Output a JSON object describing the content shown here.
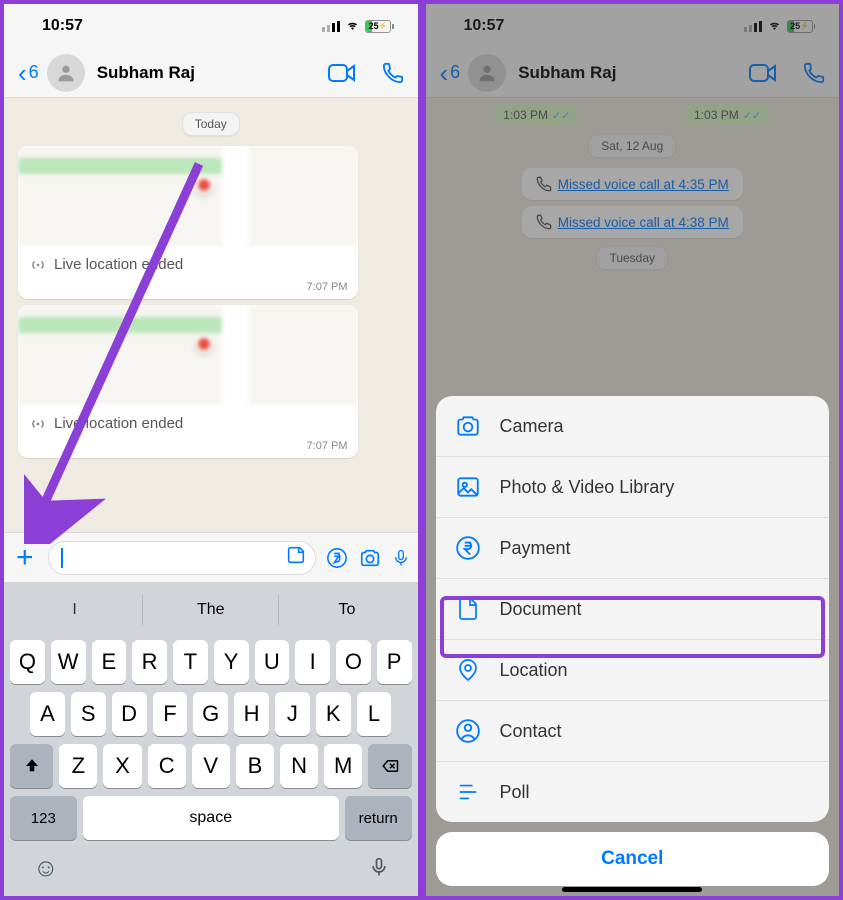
{
  "status": {
    "time": "10:57",
    "battery": "25"
  },
  "nav": {
    "back_count": "6",
    "name": "Subham Raj"
  },
  "chat_left": {
    "date": "Today",
    "loc_label": "Live location ended",
    "time": "7:07 PM"
  },
  "keyboard": {
    "sug_i": "I",
    "sug_the": "The",
    "sug_to": "To",
    "r1": [
      "Q",
      "W",
      "E",
      "R",
      "T",
      "Y",
      "U",
      "I",
      "O",
      "P"
    ],
    "r2": [
      "A",
      "S",
      "D",
      "F",
      "G",
      "H",
      "J",
      "K",
      "L"
    ],
    "r3": [
      "Z",
      "X",
      "C",
      "V",
      "B",
      "N",
      "M"
    ],
    "num": "123",
    "space": "space",
    "ret": "return"
  },
  "chat_right": {
    "t1": "1:03 PM",
    "t2": "1:03 PM",
    "date1": "Sat, 12 Aug",
    "call1": "Missed voice call at 4:35 PM",
    "call2": "Missed voice call at 4:38 PM",
    "date2": "Tuesday"
  },
  "sheet": {
    "camera": "Camera",
    "library": "Photo & Video Library",
    "payment": "Payment",
    "document": "Document",
    "location": "Location",
    "contact": "Contact",
    "poll": "Poll",
    "cancel": "Cancel"
  }
}
